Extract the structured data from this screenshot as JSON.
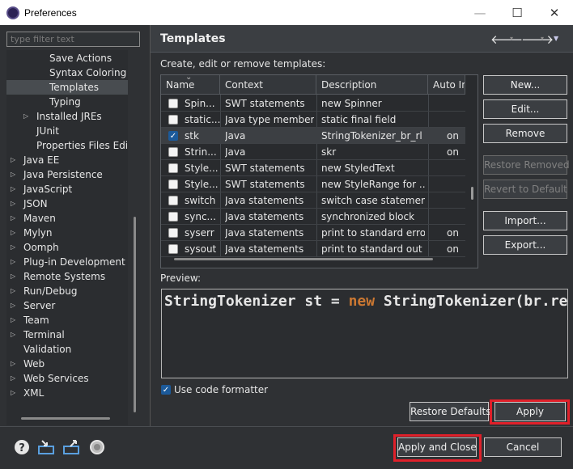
{
  "window": {
    "title": "Preferences",
    "min_glyph": "—",
    "max_glyph": "☐",
    "close_glyph": "✕"
  },
  "filter": {
    "placeholder": "type filter text"
  },
  "tree": {
    "items": [
      {
        "label": "Save Actions",
        "indent": 2,
        "twisty": ""
      },
      {
        "label": "Syntax Coloring",
        "indent": 2,
        "twisty": ""
      },
      {
        "label": "Templates",
        "indent": 2,
        "twisty": "",
        "selected": true
      },
      {
        "label": "Typing",
        "indent": 2,
        "twisty": ""
      },
      {
        "label": "Installed JREs",
        "indent": 1,
        "twisty": "▷"
      },
      {
        "label": "JUnit",
        "indent": 1,
        "twisty": ""
      },
      {
        "label": "Properties Files Editor",
        "indent": 1,
        "twisty": ""
      },
      {
        "label": "Java EE",
        "indent": 0,
        "twisty": "▷"
      },
      {
        "label": "Java Persistence",
        "indent": 0,
        "twisty": "▷"
      },
      {
        "label": "JavaScript",
        "indent": 0,
        "twisty": "▷"
      },
      {
        "label": "JSON",
        "indent": 0,
        "twisty": "▷"
      },
      {
        "label": "Maven",
        "indent": 0,
        "twisty": "▷"
      },
      {
        "label": "Mylyn",
        "indent": 0,
        "twisty": "▷"
      },
      {
        "label": "Oomph",
        "indent": 0,
        "twisty": "▷"
      },
      {
        "label": "Plug-in Development",
        "indent": 0,
        "twisty": "▷"
      },
      {
        "label": "Remote Systems",
        "indent": 0,
        "twisty": "▷"
      },
      {
        "label": "Run/Debug",
        "indent": 0,
        "twisty": "▷"
      },
      {
        "label": "Server",
        "indent": 0,
        "twisty": "▷"
      },
      {
        "label": "Team",
        "indent": 0,
        "twisty": "▷"
      },
      {
        "label": "Terminal",
        "indent": 0,
        "twisty": "▷"
      },
      {
        "label": "Validation",
        "indent": 0,
        "twisty": ""
      },
      {
        "label": "Web",
        "indent": 0,
        "twisty": "▷"
      },
      {
        "label": "Web Services",
        "indent": 0,
        "twisty": "▷"
      },
      {
        "label": "XML",
        "indent": 0,
        "twisty": "▷"
      }
    ]
  },
  "panel": {
    "title": "Templates",
    "description": "Create, edit or remove templates:",
    "nav_back": "🡐",
    "nav_forward": "🡒",
    "nav_dropdown": "▾",
    "nav_menu": "▼"
  },
  "table": {
    "columns": [
      "Name",
      "Context",
      "Description",
      "Auto In"
    ],
    "sort_indicator": "⌄",
    "rows": [
      {
        "checked": false,
        "name": "Spin...",
        "context": "SWT statements",
        "description": "new Spinner",
        "auto": ""
      },
      {
        "checked": false,
        "name": "static...",
        "context": "Java type members",
        "description": "static final field",
        "auto": ""
      },
      {
        "checked": true,
        "name": "stk",
        "context": "Java",
        "description": "StringTokenizer_br_rl",
        "auto": "on",
        "selected": true
      },
      {
        "checked": false,
        "name": "Strin...",
        "context": "Java",
        "description": "skr",
        "auto": "on"
      },
      {
        "checked": false,
        "name": "Style...",
        "context": "SWT statements",
        "description": "new StyledText",
        "auto": ""
      },
      {
        "checked": false,
        "name": "Style...",
        "context": "SWT statements",
        "description": "new StyleRange for ...",
        "auto": ""
      },
      {
        "checked": false,
        "name": "switch",
        "context": "Java statements",
        "description": "switch case statement",
        "auto": ""
      },
      {
        "checked": false,
        "name": "sync...",
        "context": "Java statements",
        "description": "synchronized block",
        "auto": ""
      },
      {
        "checked": false,
        "name": "syserr",
        "context": "Java statements",
        "description": "print to standard error",
        "auto": "on"
      },
      {
        "checked": false,
        "name": "sysout",
        "context": "Java statements",
        "description": "print to standard out",
        "auto": "on"
      }
    ]
  },
  "buttons": {
    "new": "New...",
    "edit": "Edit...",
    "remove": "Remove",
    "restore_removed": "Restore Removed",
    "revert_to_default": "Revert to Default",
    "import": "Import...",
    "export": "Export...",
    "restore_defaults": "Restore Defaults",
    "apply": "Apply",
    "apply_and_close": "Apply and Close",
    "cancel": "Cancel"
  },
  "preview": {
    "label": "Preview:",
    "code_before": "StringTokenizer st = ",
    "code_keyword": "new",
    "code_after": " StringTokenizer(br.readLine());"
  },
  "formatter": {
    "label": "Use code formatter",
    "checked": true
  },
  "colors": {
    "highlight": "#e0202a",
    "keyword": "#cc7832",
    "checkbox": "#1c5a9a"
  }
}
